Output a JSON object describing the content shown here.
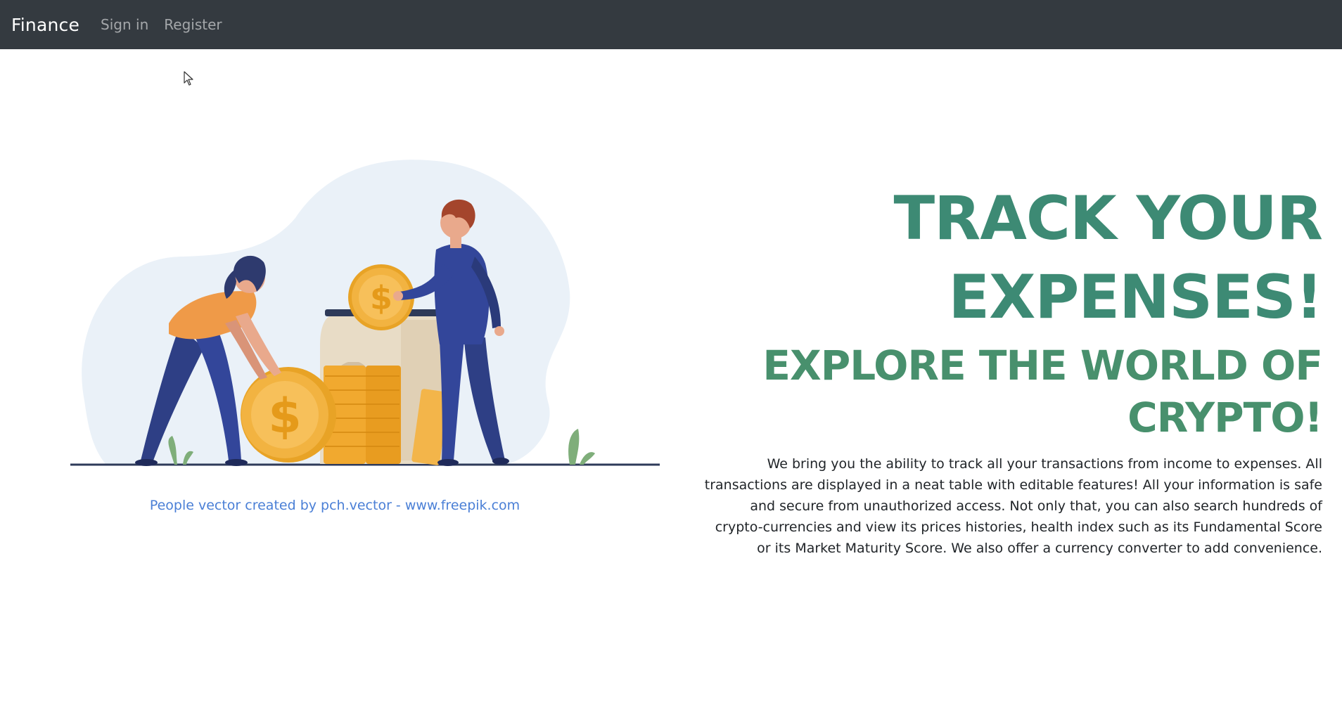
{
  "navbar": {
    "brand": "Finance",
    "links": [
      "Sign in",
      "Register"
    ]
  },
  "illustration": {
    "credit": "People vector created by pch.vector - www.freepik.com",
    "coin_symbol": "$"
  },
  "hero": {
    "title_line1": "TRACK YOUR",
    "title_line2": "EXPENSES!",
    "subtitle_line1": "EXPLORE THE WORLD OF",
    "subtitle_line2": "CRYPTO!",
    "description": "We bring you the ability to track all your transactions from income to expenses. All transactions are displayed in a neat table with editable features! All your information is safe and secure from unauthorized access. Not only that, you can also search hundreds of crypto-currencies and view its prices histories, health index such as its Fundamental Score or its Market Maturity Score. We also offer a currency converter to add convenience."
  },
  "colors": {
    "navbar_bg": "#343a40",
    "title": "#3d8a74",
    "subtitle": "#48906d",
    "link": "#4a7fd6"
  }
}
